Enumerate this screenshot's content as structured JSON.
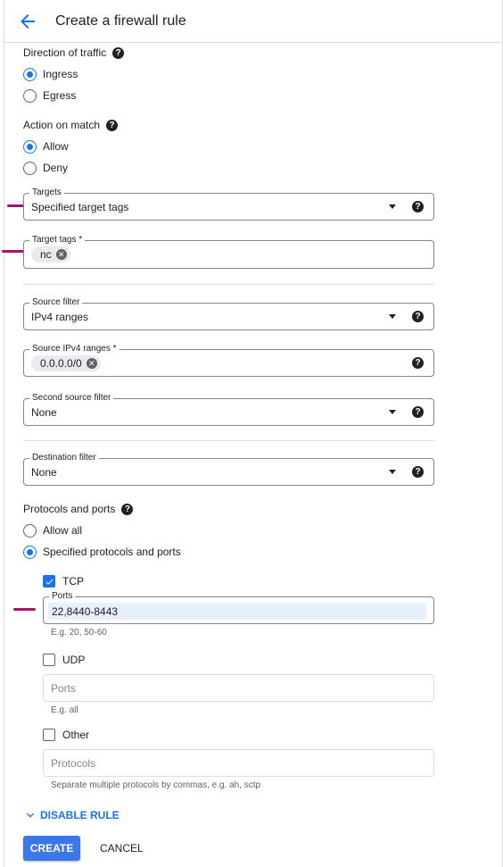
{
  "header": {
    "title": "Create a firewall rule"
  },
  "direction": {
    "label": "Direction of traffic",
    "options": [
      "Ingress",
      "Egress"
    ],
    "selected": "Ingress"
  },
  "action": {
    "label": "Action on match",
    "options": [
      "Allow",
      "Deny"
    ],
    "selected": "Allow"
  },
  "targets": {
    "label": "Targets",
    "value": "Specified target tags"
  },
  "target_tags": {
    "label": "Target tags *",
    "chips": [
      "nc"
    ]
  },
  "source_filter": {
    "label": "Source filter",
    "value": "IPv4 ranges"
  },
  "source_ranges": {
    "label": "Source IPv4 ranges *",
    "chips": [
      "0.0.0.0/0"
    ]
  },
  "second_source_filter": {
    "label": "Second source filter",
    "value": "None"
  },
  "destination_filter": {
    "label": "Destination filter",
    "value": "None"
  },
  "protocols": {
    "label": "Protocols and ports",
    "options": [
      "Allow all",
      "Specified protocols and ports"
    ],
    "selected": "Specified protocols and ports",
    "tcp": {
      "label": "TCP",
      "checked": true,
      "ports_label": "Ports",
      "ports_value": "22,8440-8443",
      "hint": "E.g. 20, 50-60"
    },
    "udp": {
      "label": "UDP",
      "checked": false,
      "ports_placeholder": "Ports",
      "hint": "E.g. all"
    },
    "other": {
      "label": "Other",
      "checked": false,
      "protocols_placeholder": "Protocols",
      "hint": "Separate multiple protocols by commas, e.g. ah, sctp"
    }
  },
  "disable_rule_label": "DISABLE RULE",
  "buttons": {
    "create": "CREATE",
    "cancel": "CANCEL"
  },
  "colors": {
    "accent": "#1a73e8",
    "annotation_marker": "#a5136c",
    "create_button": "#3b78e7"
  }
}
